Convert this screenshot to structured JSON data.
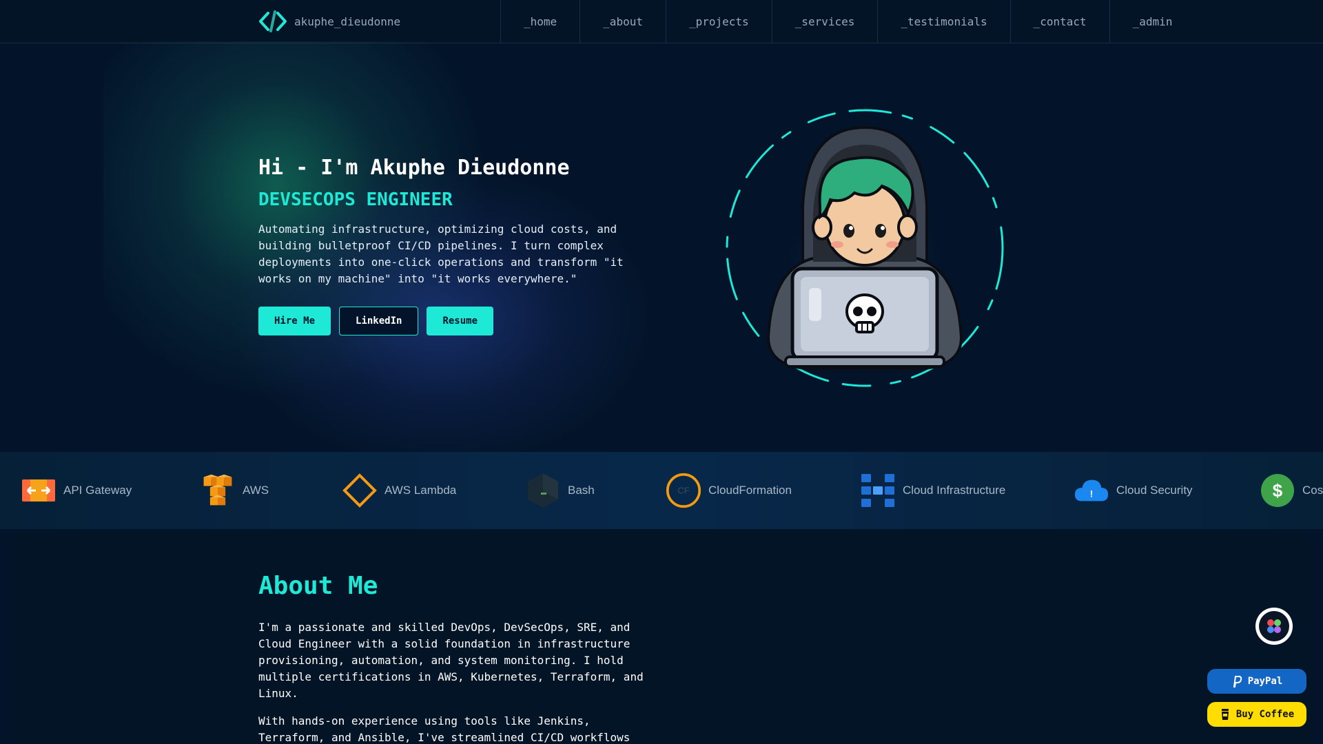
{
  "nav": {
    "brand": "akuphe_dieudonne",
    "links": [
      "_home",
      "_about",
      "_projects",
      "_services",
      "_testimonials",
      "_contact",
      "_admin"
    ]
  },
  "hero": {
    "greeting": "Hi - I'm Akuphe Dieudonne",
    "role": "DEVSECOPS ENGINEER",
    "description": "Automating infrastructure, optimizing cloud costs, and building bulletproof CI/CD pipelines. I turn complex deployments into one-click operations and transform \"it works on my machine\" into \"it works everywhere.\"",
    "buttons": {
      "hire": "Hire Me",
      "linkedin": "LinkedIn",
      "resume": "Resume"
    }
  },
  "tech_strip": {
    "items": [
      {
        "label": "API Gateway",
        "icon": "api-gateway-icon"
      },
      {
        "label": "AWS",
        "icon": "aws-icon"
      },
      {
        "label": "AWS Lambda",
        "icon": "aws-lambda-icon"
      },
      {
        "label": "Bash",
        "icon": "bash-icon"
      },
      {
        "label": "CloudFormation",
        "icon": "cloudformation-icon"
      },
      {
        "label": "Cloud Infrastructure",
        "icon": "cloud-infrastructure-icon"
      },
      {
        "label": "Cloud Security",
        "icon": "cloud-security-icon"
      },
      {
        "label": "Cos",
        "icon": "cost-icon"
      }
    ]
  },
  "about": {
    "title": "About Me",
    "paragraph1": "I'm a passionate and skilled DevOps, DevSecOps, SRE, and Cloud Engineer with a solid foundation in infrastructure provisioning, automation, and system monitoring. I hold multiple certifications in AWS, Kubernetes, Terraform, and Linux.",
    "paragraph2": "With hands-on experience using tools like Jenkins, Terraform, and Ansible, I've streamlined CI/CD workflows"
  },
  "widgets": {
    "paypal": "PayPal",
    "coffee": "Buy Coffee"
  },
  "colors": {
    "accent": "#1de9d6",
    "background": "#03142a",
    "paypal": "#1466c4",
    "coffee": "#ffdd00"
  }
}
